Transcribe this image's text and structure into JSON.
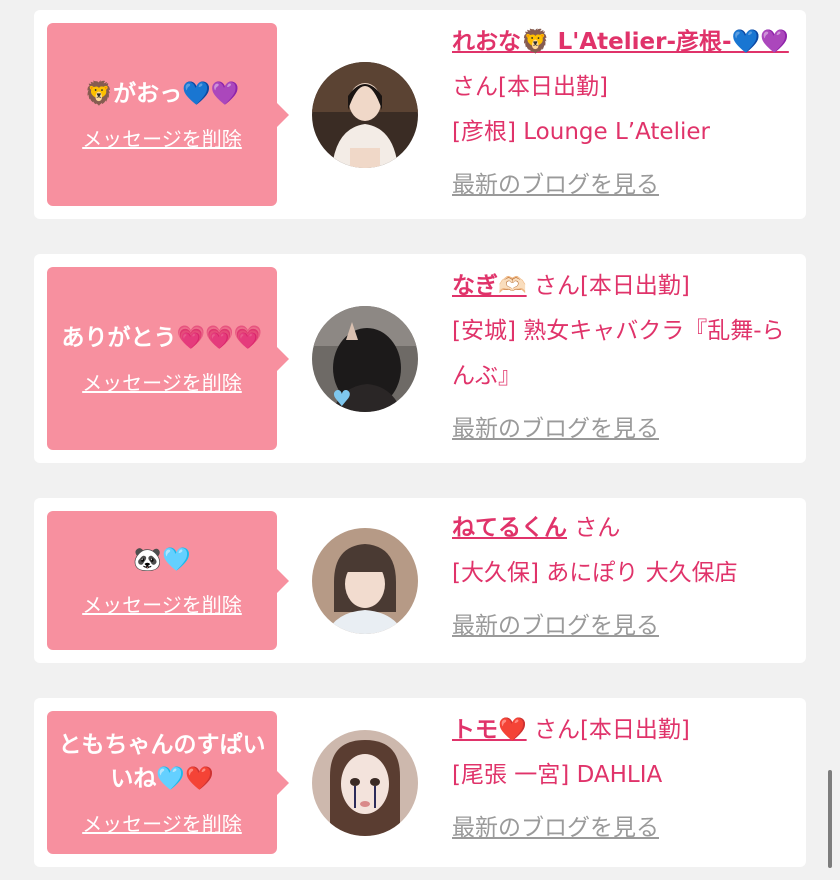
{
  "items": [
    {
      "message": "🦁がおっ💙💜",
      "delete_label": "メッセージを削除",
      "name": "れおな🦁 L'Atelier-彦根-💙💜",
      "suffix": "さん",
      "status": "[本日出勤]",
      "shop": "[彦根] Lounge L’Atelier",
      "blog_label": "最新のブログを見る",
      "avatar": {
        "bg": "#3a2c24",
        "accent": "#f3ece6"
      }
    },
    {
      "message": "ありがとう💗💗💗",
      "delete_label": "メッセージを削除",
      "name": "なぎ🫶🏻",
      "suffix": "さん",
      "status": "[本日出勤]",
      "shop": "[安城] 熟女キャバクラ『乱舞-らんぶ』",
      "blog_label": "最新のブログを見る",
      "avatar": {
        "bg": "#6e6a66",
        "accent": "#1c1a1a"
      }
    },
    {
      "message": "🐼🩵",
      "delete_label": "メッセージを削除",
      "name": "ねてるくん",
      "suffix": "さん",
      "status": "",
      "shop": "[大久保] あにぽり 大久保店",
      "blog_label": "最新のブログを見る",
      "avatar": {
        "bg": "#b69a86",
        "accent": "#4a3a33"
      }
    },
    {
      "message": "ともちゃんのすぱいいね🩵❤️",
      "delete_label": "メッセージを削除",
      "name": "トモ❤️",
      "suffix": "さん",
      "status": "[本日出勤]",
      "shop": "[尾張 一宮] DAHLIA",
      "blog_label": "最新のブログを見る",
      "avatar": {
        "bg": "#cdb8ad",
        "accent": "#5a3d31"
      }
    }
  ],
  "colors": {
    "background": "#f1f1f1",
    "bubble": "#f7909f",
    "name_pink": "#e0336a",
    "blog_gray": "#9a9a9a"
  }
}
